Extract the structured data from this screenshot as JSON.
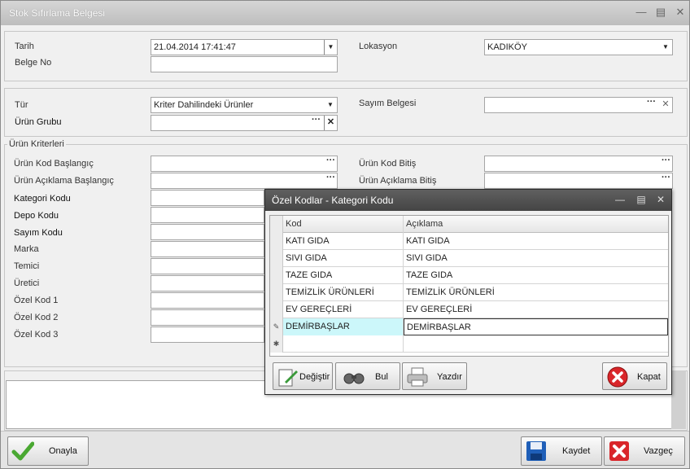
{
  "window": {
    "title": "Stok Sıfırlama Belgesi"
  },
  "header": {
    "tarih_label": "Tarih",
    "tarih_value": "21.04.2014 17:41:47",
    "belge_no_label": "Belge No",
    "belge_no_value": "",
    "lokasyon_label": "Lokasyon",
    "lokasyon_value": "KADIKÖY"
  },
  "type_section": {
    "tur_label": "Tür",
    "tur_value": "Kriter Dahilindeki Ürünler",
    "urun_grubu_label": "Ürün Grubu",
    "urun_grubu_value": "",
    "sayim_belgesi_label": "Sayım Belgesi",
    "sayim_belgesi_value": ""
  },
  "criteria": {
    "title": "Ürün Kriterleri",
    "left_labels": [
      "Ürün Kod Başlangıç",
      "Ürün Açıklama Başlangıç",
      "Kategori Kodu",
      "Depo Kodu",
      "Sayım Kodu",
      "Marka",
      "Temici",
      "Üretici",
      "Özel Kod 1",
      "Özel Kod 2",
      "Özel Kod 3"
    ],
    "right_labels": [
      "Ürün Kod Bitiş",
      "Ürün Açıklama Bitiş"
    ]
  },
  "popup": {
    "title": "Özel Kodlar - Kategori Kodu",
    "columns": [
      "Kod",
      "Açıklama"
    ],
    "rows": [
      [
        "KATI GIDA",
        "KATI GIDA"
      ],
      [
        "SIVI GIDA",
        "SIVI GIDA"
      ],
      [
        "TAZE GIDA",
        "TAZE GIDA"
      ],
      [
        "TEMİZLİK ÜRÜNLERİ",
        "TEMİZLİK ÜRÜNLERİ"
      ],
      [
        "EV GEREÇLERİ",
        "EV GEREÇLERİ"
      ],
      [
        "DEMİRBAŞLAR",
        "DEMİRBAŞLAR"
      ]
    ],
    "buttons": {
      "edit": "Değiştir",
      "find": "Bul",
      "print": "Yazdır",
      "close": "Kapat"
    }
  },
  "footer": {
    "approve": "Onayla",
    "save": "Kaydet",
    "cancel": "Vazgeç"
  },
  "colors": {
    "selected_cell": "#ccf7fa",
    "title_dark": "#4a4a4a"
  }
}
